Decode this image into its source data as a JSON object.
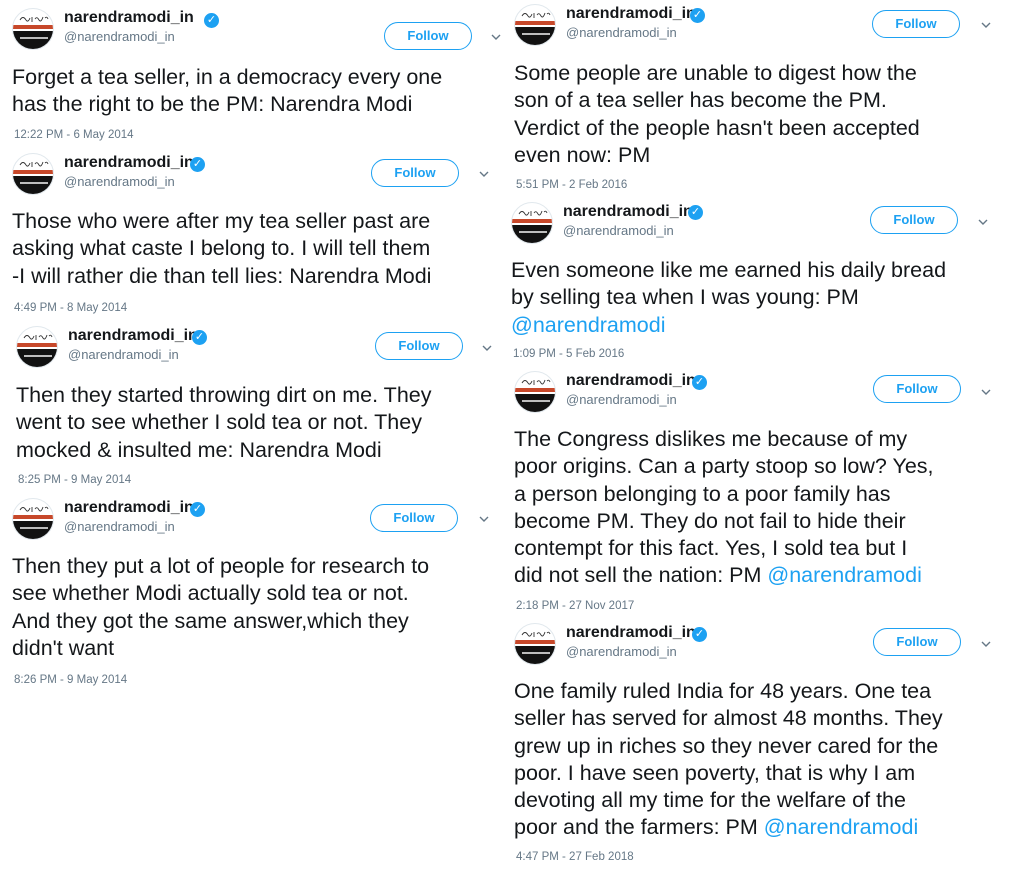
{
  "tweets": [
    {
      "name": "narendramodi_in",
      "handle": "@narendramodi_in",
      "follow_label": "Follow",
      "lines": [
        "Forget a tea seller, in a democracy every one",
        "has the right to be the PM: Narendra Modi"
      ],
      "time": "12:22 PM - 6 May 2014"
    },
    {
      "name": "narendramodi_in",
      "handle": "@narendramodi_in",
      "follow_label": "Follow",
      "lines": [
        "Those who were after my tea seller past are",
        "asking what caste I belong to. I will tell them",
        "-I will rather die than tell lies: Narendra Modi"
      ],
      "time": "4:49 PM - 8 May 2014"
    },
    {
      "name": "narendramodi_in",
      "handle": "@narendramodi_in",
      "follow_label": "Follow",
      "lines": [
        "Then they started throwing dirt on me. They",
        "went to see whether I sold tea or not. They",
        "mocked & insulted me: Narendra Modi"
      ],
      "time": "8:25 PM - 9 May 2014"
    },
    {
      "name": "narendramodi_in",
      "handle": "@narendramodi_in",
      "follow_label": "Follow",
      "lines": [
        "Then they put a lot of people for research to",
        "see whether Modi actually sold tea or not.",
        "And they got the same answer,which they",
        "didn't want"
      ],
      "time": "8:26 PM - 9 May 2014"
    },
    {
      "name": "narendramodi_in",
      "handle": "@narendramodi_in",
      "follow_label": "Follow",
      "lines": [
        "Some people are unable to digest how the",
        "son of a tea seller has become the PM.",
        "Verdict of the people hasn't been accepted",
        "even now: PM"
      ],
      "time": "5:51 PM - 2 Feb 2016"
    },
    {
      "name": "narendramodi_in",
      "handle": "@narendramodi_in",
      "follow_label": "Follow",
      "lines": [
        "Even someone like me earned his daily bread",
        "by selling tea when I was young: PM"
      ],
      "mention": "@narendramodi",
      "time": "1:09 PM - 5 Feb 2016"
    },
    {
      "name": "narendramodi_in",
      "handle": "@narendramodi_in",
      "follow_label": "Follow",
      "lines": [
        "The Congress dislikes me because of my",
        "poor origins. Can a party stoop so low? Yes,",
        "a person belonging to a poor family has",
        "become PM. They do not fail to hide their",
        "contempt for this fact. Yes, I sold tea but I",
        "did not sell the nation: PM "
      ],
      "mention": "@narendramodi",
      "time": "2:18 PM - 27 Nov 2017"
    },
    {
      "name": "narendramodi_in",
      "handle": "@narendramodi_in",
      "follow_label": "Follow",
      "lines": [
        "One family ruled India for 48 years. One tea",
        "seller has served for almost 48 months. They",
        "grew up in riches so they never cared for the",
        "poor. I have seen poverty, that is why I am",
        "devoting all my time for the welfare of the",
        "poor and the farmers: PM "
      ],
      "mention": "@narendramodi",
      "time": "4:47 PM - 27 Feb 2018"
    }
  ]
}
